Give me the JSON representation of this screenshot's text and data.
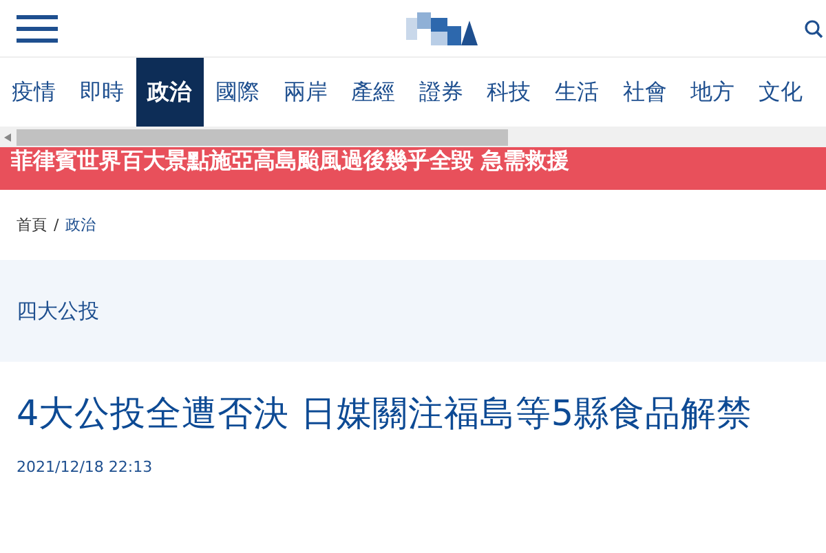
{
  "nav": {
    "tabs": [
      {
        "label": "疫情",
        "selected": false
      },
      {
        "label": "即時",
        "selected": false
      },
      {
        "label": "政治",
        "selected": true
      },
      {
        "label": "國際",
        "selected": false
      },
      {
        "label": "兩岸",
        "selected": false
      },
      {
        "label": "產經",
        "selected": false
      },
      {
        "label": "證券",
        "selected": false
      },
      {
        "label": "科技",
        "selected": false
      },
      {
        "label": "生活",
        "selected": false
      },
      {
        "label": "社會",
        "selected": false
      },
      {
        "label": "地方",
        "selected": false
      },
      {
        "label": "文化",
        "selected": false
      }
    ]
  },
  "ticker": "菲律賓世界百大景點施亞高島颱風過後幾乎全毀 急需救援",
  "breadcrumb": [
    "首頁",
    "/",
    "政治"
  ],
  "topic": "四大公投",
  "article": {
    "headline": "4大公投全遭否決 日媒關注福島等5縣食品解禁",
    "date": "2021/12/18 22:13"
  }
}
